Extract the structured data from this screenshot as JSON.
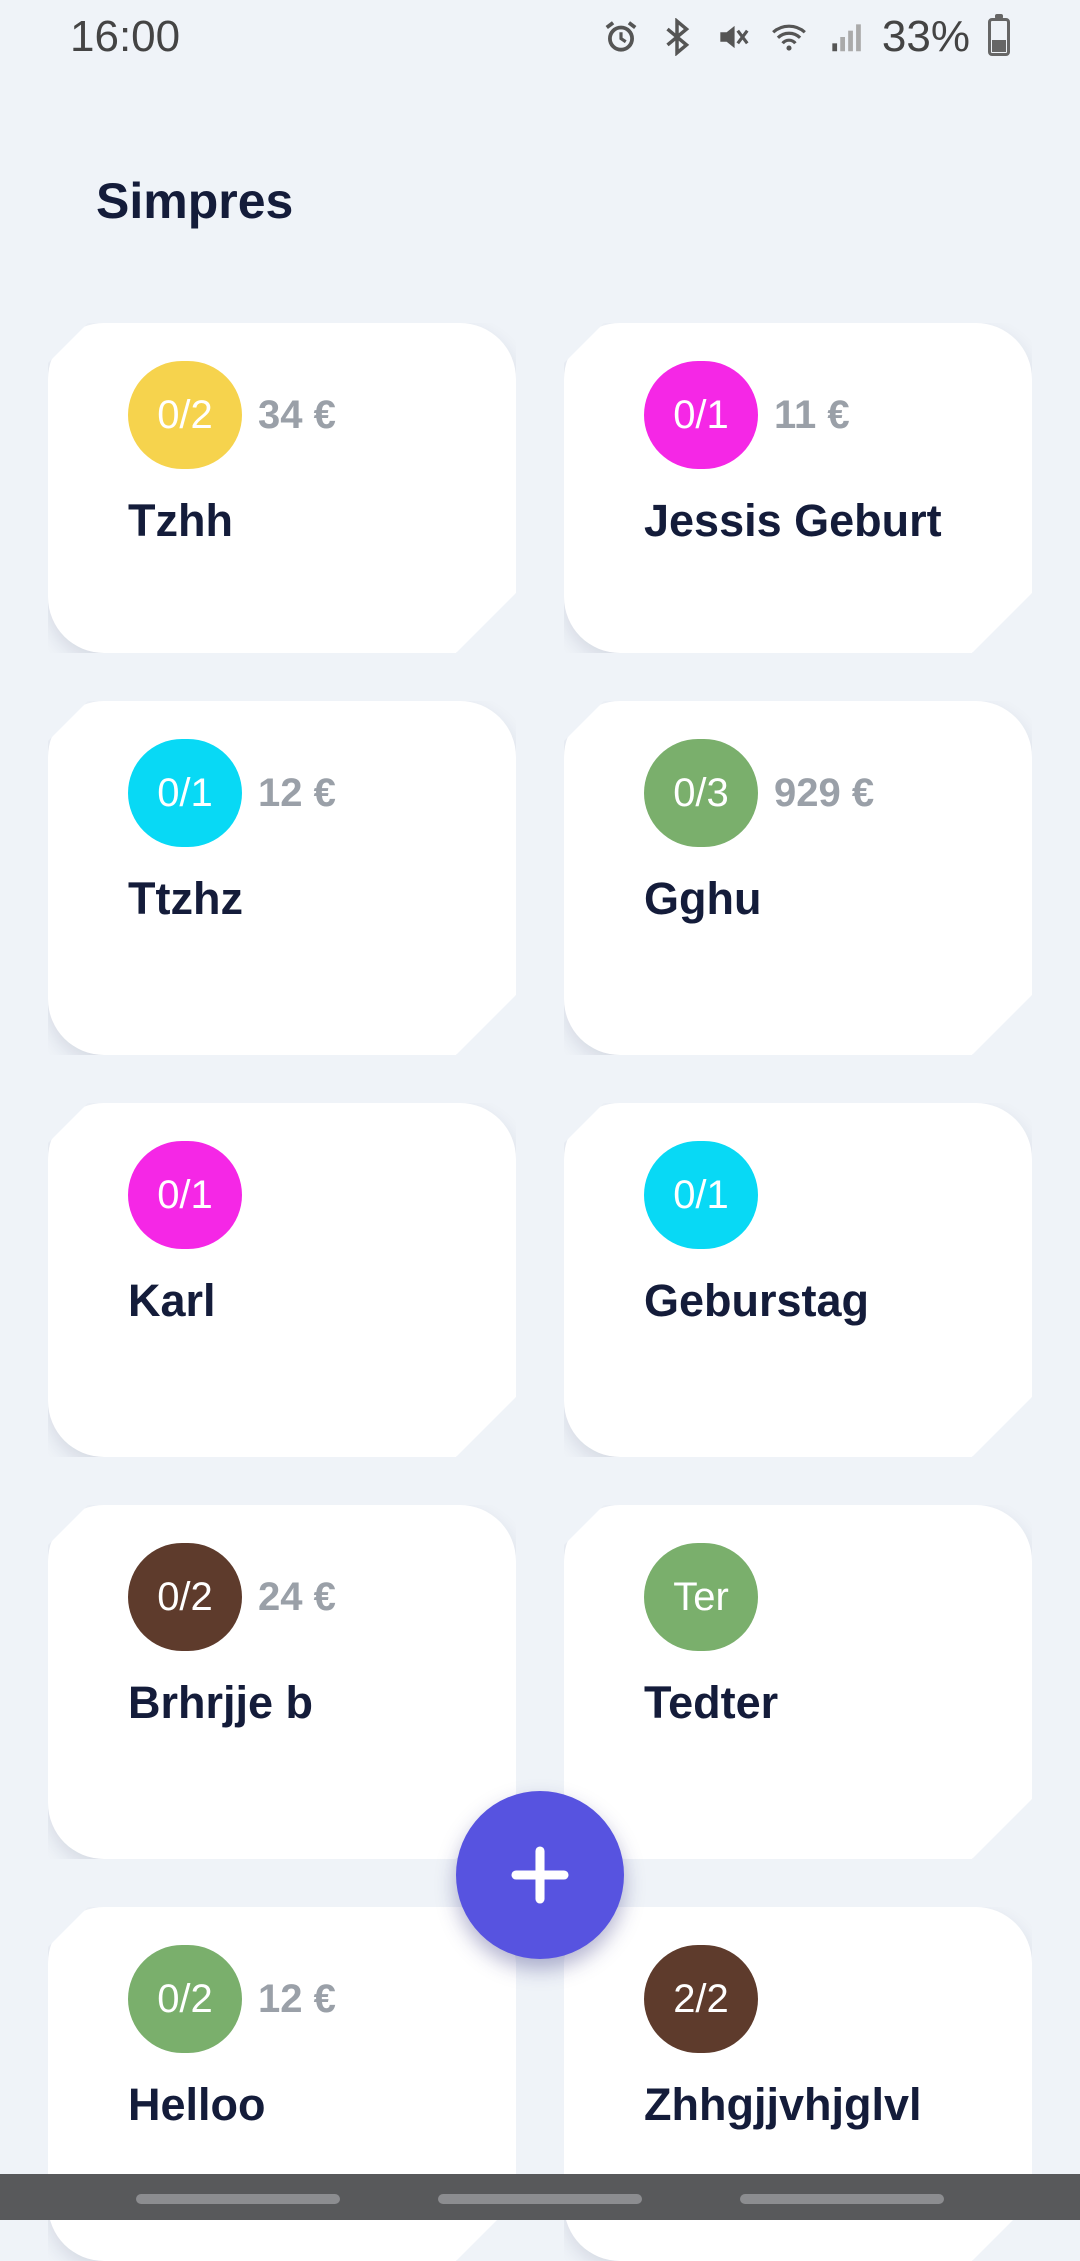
{
  "status": {
    "time": "16:00",
    "battery": "33%",
    "icons": [
      "alarm-icon",
      "bluetooth-icon",
      "mute-icon",
      "wifi-icon",
      "signal-icon",
      "battery-icon"
    ]
  },
  "header": {
    "title": "Simpres"
  },
  "cards": [
    {
      "badge": "0/2",
      "amount": "34 €",
      "title": "Tzhh",
      "color": "#f6d34d"
    },
    {
      "badge": "0/1",
      "amount": "11 €",
      "title": "Jessis Geburt",
      "color": "#f527e6"
    },
    {
      "badge": "0/1",
      "amount": "12 €",
      "title": "Ttzhz",
      "color": "#08d9f5"
    },
    {
      "badge": "0/3",
      "amount": "929 €",
      "title": "Gghu",
      "color": "#7aaf6c"
    },
    {
      "badge": "0/1",
      "amount": "",
      "title": "Karl",
      "color": "#f527e6"
    },
    {
      "badge": "0/1",
      "amount": "",
      "title": "Geburstag",
      "color": "#08d9f5"
    },
    {
      "badge": "0/2",
      "amount": "24 €",
      "title": "Brhrjje b",
      "color": "#5e3b2c"
    },
    {
      "badge": "Ter",
      "amount": "",
      "title": "Tedter",
      "color": "#7aaf6c"
    },
    {
      "badge": "0/2",
      "amount": "12 €",
      "title": "Helloo",
      "color": "#7aaf6c"
    },
    {
      "badge": "2/2",
      "amount": "",
      "title": "Zhhgjjvhjglvl",
      "color": "#5e3b2c"
    }
  ],
  "fab": {
    "icon": "plus-icon",
    "color": "#5753e0"
  }
}
